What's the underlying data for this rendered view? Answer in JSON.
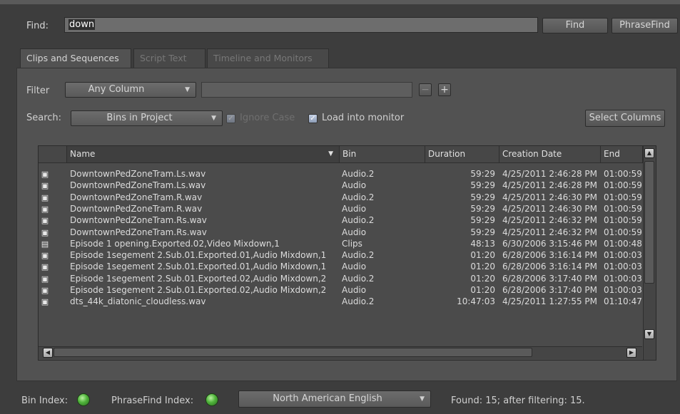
{
  "find": {
    "label": "Find:",
    "value": "down",
    "find_button": "Find",
    "phrasefind_button": "PhraseFind"
  },
  "tabs": [
    {
      "label": "Clips and Sequences",
      "active": true
    },
    {
      "label": "Script Text",
      "active": false
    },
    {
      "label": "Timeline and Monitors",
      "active": false
    }
  ],
  "filter": {
    "label": "Filter",
    "column_select": "Any Column",
    "value": "",
    "minus_label": "−",
    "plus_label": "+"
  },
  "search": {
    "label": "Search:",
    "scope_select": "Bins in Project",
    "ignore_case_label": "Ignore Case",
    "ignore_case_checked": true,
    "ignore_case_enabled": false,
    "load_monitor_label": "Load into monitor",
    "load_monitor_checked": true,
    "select_columns_button": "Select Columns"
  },
  "table": {
    "columns": [
      "",
      "Name",
      "Bin",
      "Duration",
      "Creation Date",
      "End"
    ],
    "sorted_column": "Name",
    "rows": [
      {
        "icon": "audio-clip-icon",
        "name": "DowntownPedZoneTram.Ls.wav",
        "bin": "Audio.2",
        "duration": "59:29",
        "creation_date": "4/25/2011 2:46:28 PM",
        "end": "01:00:59"
      },
      {
        "icon": "audio-clip-icon",
        "name": "DowntownPedZoneTram.Ls.wav",
        "bin": "Audio",
        "duration": "59:29",
        "creation_date": "4/25/2011 2:46:28 PM",
        "end": "01:00:59"
      },
      {
        "icon": "audio-clip-icon",
        "name": "DowntownPedZoneTram.R.wav",
        "bin": "Audio.2",
        "duration": "59:29",
        "creation_date": "4/25/2011 2:46:30 PM",
        "end": "01:00:59"
      },
      {
        "icon": "audio-clip-icon",
        "name": "DowntownPedZoneTram.R.wav",
        "bin": "Audio",
        "duration": "59:29",
        "creation_date": "4/25/2011 2:46:30 PM",
        "end": "01:00:59"
      },
      {
        "icon": "audio-clip-icon",
        "name": "DowntownPedZoneTram.Rs.wav",
        "bin": "Audio.2",
        "duration": "59:29",
        "creation_date": "4/25/2011 2:46:32 PM",
        "end": "01:00:59"
      },
      {
        "icon": "audio-clip-icon",
        "name": "DowntownPedZoneTram.Rs.wav",
        "bin": "Audio",
        "duration": "59:29",
        "creation_date": "4/25/2011 2:46:32 PM",
        "end": "01:00:59"
      },
      {
        "icon": "video-clip-icon",
        "name": "Episode 1 opening.Exported.02,Video Mixdown,1",
        "bin": "Clips",
        "duration": "48:13",
        "creation_date": "6/30/2006 3:15:46 PM",
        "end": "01:00:48"
      },
      {
        "icon": "audio-clip-icon",
        "name": "Episode 1segement 2.Sub.01.Exported.01,Audio Mixdown,1",
        "bin": "Audio.2",
        "duration": "01:20",
        "creation_date": "6/28/2006 3:16:14 PM",
        "end": "01:00:03"
      },
      {
        "icon": "audio-clip-icon",
        "name": "Episode 1segement 2.Sub.01.Exported.01,Audio Mixdown,1",
        "bin": "Audio",
        "duration": "01:20",
        "creation_date": "6/28/2006 3:16:14 PM",
        "end": "01:00:03"
      },
      {
        "icon": "audio-clip-icon",
        "name": "Episode 1segement 2.Sub.01.Exported.02,Audio Mixdown,2",
        "bin": "Audio.2",
        "duration": "01:20",
        "creation_date": "6/28/2006 3:17:40 PM",
        "end": "01:00:03"
      },
      {
        "icon": "audio-clip-icon",
        "name": "Episode 1segement 2.Sub.01.Exported.02,Audio Mixdown,2",
        "bin": "Audio",
        "duration": "01:20",
        "creation_date": "6/28/2006 3:17:40 PM",
        "end": "01:00:03"
      },
      {
        "icon": "audio-clip-icon",
        "name": "dts_44k_diatonic_cloudless.wav",
        "bin": "Audio.2",
        "duration": "10:47:03",
        "creation_date": "4/25/2011 1:27:55 PM",
        "end": "01:10:47"
      }
    ]
  },
  "status": {
    "bin_index_label": "Bin Index:",
    "phrasefind_index_label": "PhraseFind Index:",
    "language_select": "North American English",
    "found_text": "Found: 15; after filtering: 15."
  },
  "colors": {
    "background": "#3d3d3d",
    "panel": "#525252",
    "index_ok": "#4fb33a"
  }
}
